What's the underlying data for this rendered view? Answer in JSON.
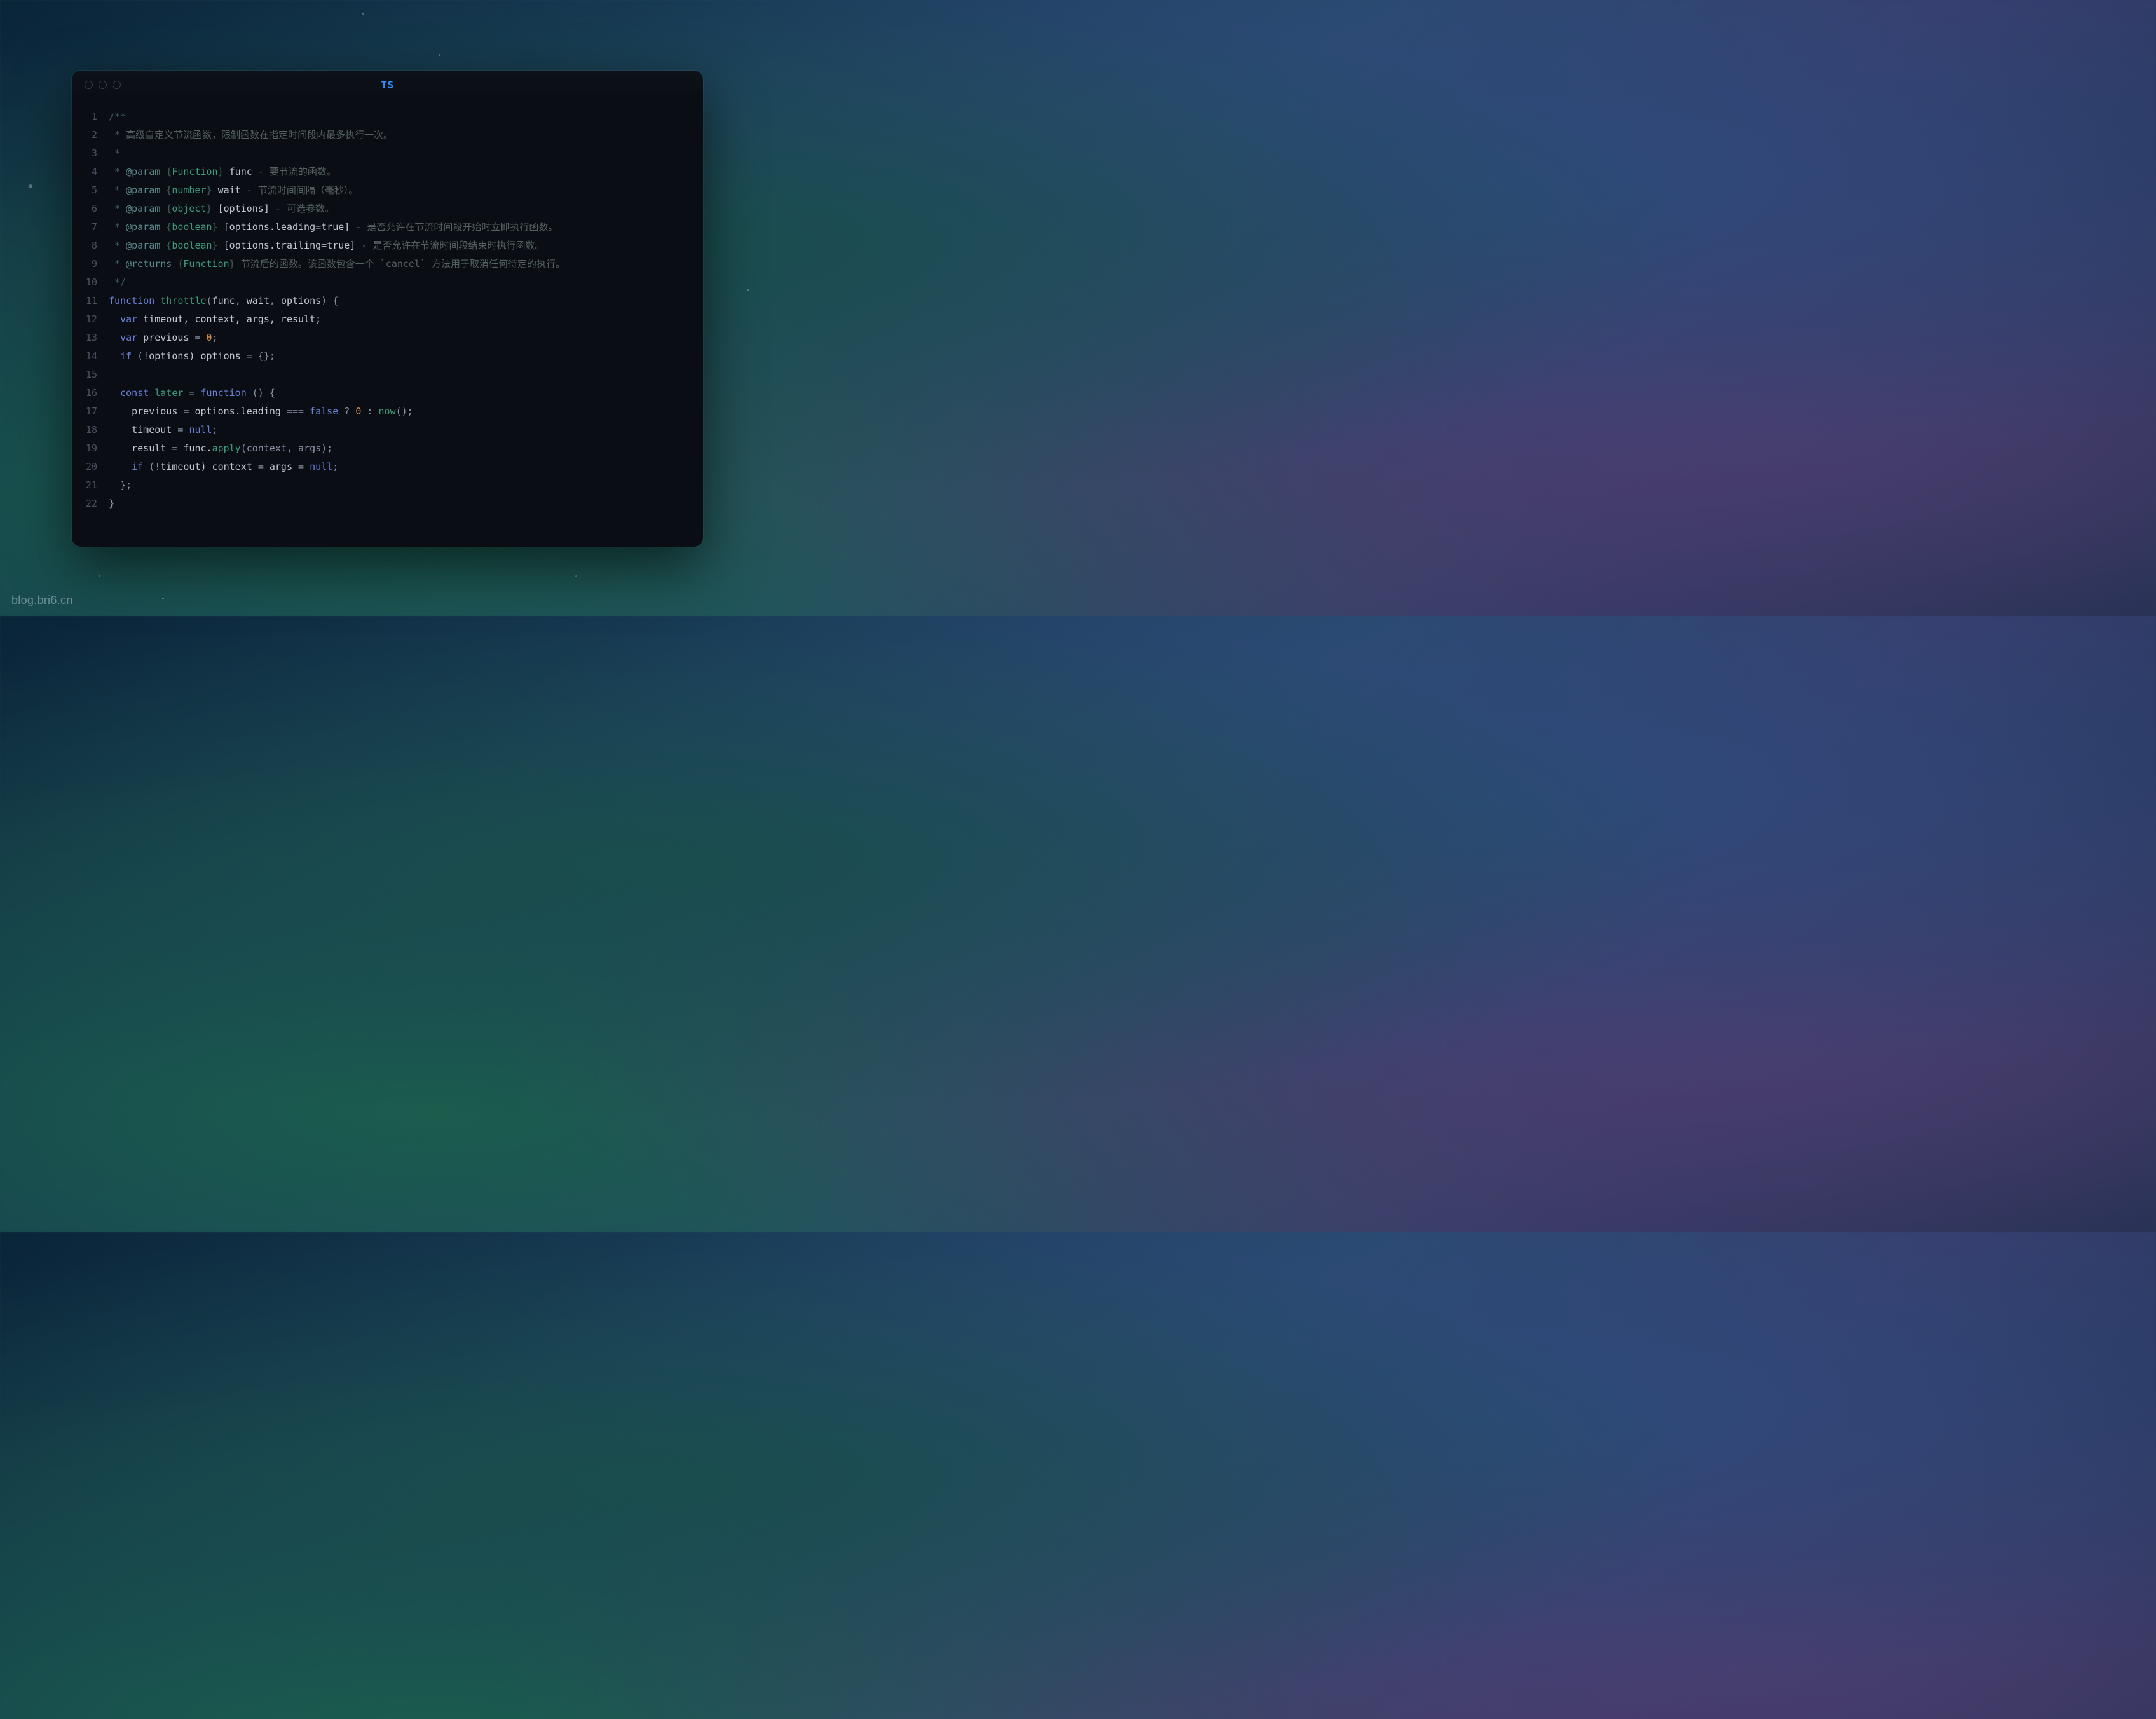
{
  "window": {
    "title": "TS"
  },
  "watermark": "blog.bri6.cn",
  "code": {
    "lines": [
      {
        "n": "1",
        "tokens": [
          {
            "t": "/**",
            "c": "c-comment"
          }
        ]
      },
      {
        "n": "2",
        "tokens": [
          {
            "t": " * ",
            "c": "c-comment"
          },
          {
            "t": "高级自定义节流函数，限制函数在指定时间段内最多执行一次。",
            "c": "c-desc"
          }
        ]
      },
      {
        "n": "3",
        "tokens": [
          {
            "t": " *",
            "c": "c-comment"
          }
        ]
      },
      {
        "n": "4",
        "tokens": [
          {
            "t": " * ",
            "c": "c-comment"
          },
          {
            "t": "@param",
            "c": "c-tag"
          },
          {
            "t": " {",
            "c": "c-comment"
          },
          {
            "t": "Function",
            "c": "c-type"
          },
          {
            "t": "} ",
            "c": "c-comment"
          },
          {
            "t": "func",
            "c": "c-id"
          },
          {
            "t": " - ",
            "c": "c-comment"
          },
          {
            "t": "要节流的函数。",
            "c": "c-desc"
          }
        ]
      },
      {
        "n": "5",
        "tokens": [
          {
            "t": " * ",
            "c": "c-comment"
          },
          {
            "t": "@param",
            "c": "c-tag"
          },
          {
            "t": " {",
            "c": "c-comment"
          },
          {
            "t": "number",
            "c": "c-type"
          },
          {
            "t": "} ",
            "c": "c-comment"
          },
          {
            "t": "wait",
            "c": "c-id"
          },
          {
            "t": " - ",
            "c": "c-comment"
          },
          {
            "t": "节流时间间隔（毫秒）。",
            "c": "c-desc"
          }
        ]
      },
      {
        "n": "6",
        "tokens": [
          {
            "t": " * ",
            "c": "c-comment"
          },
          {
            "t": "@param",
            "c": "c-tag"
          },
          {
            "t": " {",
            "c": "c-comment"
          },
          {
            "t": "object",
            "c": "c-type"
          },
          {
            "t": "} ",
            "c": "c-comment"
          },
          {
            "t": "[options]",
            "c": "c-id"
          },
          {
            "t": " - ",
            "c": "c-comment"
          },
          {
            "t": "可选参数。",
            "c": "c-desc"
          }
        ]
      },
      {
        "n": "7",
        "tokens": [
          {
            "t": " * ",
            "c": "c-comment"
          },
          {
            "t": "@param",
            "c": "c-tag"
          },
          {
            "t": " {",
            "c": "c-comment"
          },
          {
            "t": "boolean",
            "c": "c-type"
          },
          {
            "t": "} ",
            "c": "c-comment"
          },
          {
            "t": "[options.leading=true]",
            "c": "c-id"
          },
          {
            "t": " - ",
            "c": "c-comment"
          },
          {
            "t": "是否允许在节流时间段开始时立即执行函数。",
            "c": "c-desc"
          }
        ]
      },
      {
        "n": "8",
        "tokens": [
          {
            "t": " * ",
            "c": "c-comment"
          },
          {
            "t": "@param",
            "c": "c-tag"
          },
          {
            "t": " {",
            "c": "c-comment"
          },
          {
            "t": "boolean",
            "c": "c-type"
          },
          {
            "t": "} ",
            "c": "c-comment"
          },
          {
            "t": "[options.trailing=true]",
            "c": "c-id"
          },
          {
            "t": " - ",
            "c": "c-comment"
          },
          {
            "t": "是否允许在节流时间段结束时执行函数。",
            "c": "c-desc"
          }
        ]
      },
      {
        "n": "9",
        "tokens": [
          {
            "t": " * ",
            "c": "c-comment"
          },
          {
            "t": "@returns",
            "c": "c-tag"
          },
          {
            "t": " {",
            "c": "c-comment"
          },
          {
            "t": "Function",
            "c": "c-type"
          },
          {
            "t": "} ",
            "c": "c-comment"
          },
          {
            "t": "节流后的函数。该函数包含一个 `cancel` 方法用于取消任何待定的执行。",
            "c": "c-desc"
          }
        ]
      },
      {
        "n": "10",
        "tokens": [
          {
            "t": " */",
            "c": "c-comment"
          }
        ]
      },
      {
        "n": "11",
        "tokens": [
          {
            "t": "function",
            "c": "c-kw"
          },
          {
            "t": " ",
            "c": ""
          },
          {
            "t": "throttle",
            "c": "c-fn"
          },
          {
            "t": "(",
            "c": "c-punc"
          },
          {
            "t": "func",
            "c": "c-param"
          },
          {
            "t": ", ",
            "c": "c-punc"
          },
          {
            "t": "wait",
            "c": "c-param"
          },
          {
            "t": ", ",
            "c": "c-punc"
          },
          {
            "t": "options",
            "c": "c-param"
          },
          {
            "t": ") {",
            "c": "c-punc"
          }
        ]
      },
      {
        "n": "12",
        "tokens": [
          {
            "t": "  ",
            "c": ""
          },
          {
            "t": "var",
            "c": "c-kw"
          },
          {
            "t": " timeout, context, args, result;",
            "c": "c-id"
          }
        ]
      },
      {
        "n": "13",
        "tokens": [
          {
            "t": "  ",
            "c": ""
          },
          {
            "t": "var",
            "c": "c-kw"
          },
          {
            "t": " previous ",
            "c": "c-id"
          },
          {
            "t": "=",
            "c": "c-op"
          },
          {
            "t": " ",
            "c": ""
          },
          {
            "t": "0",
            "c": "c-num"
          },
          {
            "t": ";",
            "c": "c-punc"
          }
        ]
      },
      {
        "n": "14",
        "tokens": [
          {
            "t": "  ",
            "c": ""
          },
          {
            "t": "if",
            "c": "c-kw"
          },
          {
            "t": " (",
            "c": "c-punc"
          },
          {
            "t": "!",
            "c": "c-op"
          },
          {
            "t": "options) options ",
            "c": "c-id"
          },
          {
            "t": "=",
            "c": "c-op"
          },
          {
            "t": " {};",
            "c": "c-punc"
          }
        ]
      },
      {
        "n": "15",
        "tokens": [
          {
            "t": "",
            "c": ""
          }
        ]
      },
      {
        "n": "16",
        "tokens": [
          {
            "t": "  ",
            "c": ""
          },
          {
            "t": "const",
            "c": "c-kw"
          },
          {
            "t": " ",
            "c": ""
          },
          {
            "t": "later",
            "c": "c-fn"
          },
          {
            "t": " ",
            "c": ""
          },
          {
            "t": "=",
            "c": "c-op"
          },
          {
            "t": " ",
            "c": ""
          },
          {
            "t": "function",
            "c": "c-kw"
          },
          {
            "t": " () {",
            "c": "c-punc"
          }
        ]
      },
      {
        "n": "17",
        "tokens": [
          {
            "t": "    previous ",
            "c": "c-id"
          },
          {
            "t": "=",
            "c": "c-op"
          },
          {
            "t": " options.leading ",
            "c": "c-id"
          },
          {
            "t": "===",
            "c": "c-op"
          },
          {
            "t": " ",
            "c": ""
          },
          {
            "t": "false",
            "c": "c-kw"
          },
          {
            "t": " ? ",
            "c": "c-op"
          },
          {
            "t": "0",
            "c": "c-num"
          },
          {
            "t": " : ",
            "c": "c-op"
          },
          {
            "t": "now",
            "c": "c-call"
          },
          {
            "t": "();",
            "c": "c-punc"
          }
        ]
      },
      {
        "n": "18",
        "tokens": [
          {
            "t": "    timeout ",
            "c": "c-id"
          },
          {
            "t": "=",
            "c": "c-op"
          },
          {
            "t": " ",
            "c": ""
          },
          {
            "t": "null",
            "c": "c-kw"
          },
          {
            "t": ";",
            "c": "c-punc"
          }
        ]
      },
      {
        "n": "19",
        "tokens": [
          {
            "t": "    result ",
            "c": "c-id"
          },
          {
            "t": "=",
            "c": "c-op"
          },
          {
            "t": " func.",
            "c": "c-id"
          },
          {
            "t": "apply",
            "c": "c-call"
          },
          {
            "t": "(context, args);",
            "c": "c-punc"
          }
        ]
      },
      {
        "n": "20",
        "tokens": [
          {
            "t": "    ",
            "c": ""
          },
          {
            "t": "if",
            "c": "c-kw"
          },
          {
            "t": " (",
            "c": "c-punc"
          },
          {
            "t": "!",
            "c": "c-op"
          },
          {
            "t": "timeout) context ",
            "c": "c-id"
          },
          {
            "t": "=",
            "c": "c-op"
          },
          {
            "t": " args ",
            "c": "c-id"
          },
          {
            "t": "=",
            "c": "c-op"
          },
          {
            "t": " ",
            "c": ""
          },
          {
            "t": "null",
            "c": "c-kw"
          },
          {
            "t": ";",
            "c": "c-punc"
          }
        ]
      },
      {
        "n": "21",
        "tokens": [
          {
            "t": "  };",
            "c": "c-punc"
          }
        ]
      },
      {
        "n": "22",
        "tokens": [
          {
            "t": "}",
            "c": "c-punc"
          }
        ]
      }
    ]
  }
}
